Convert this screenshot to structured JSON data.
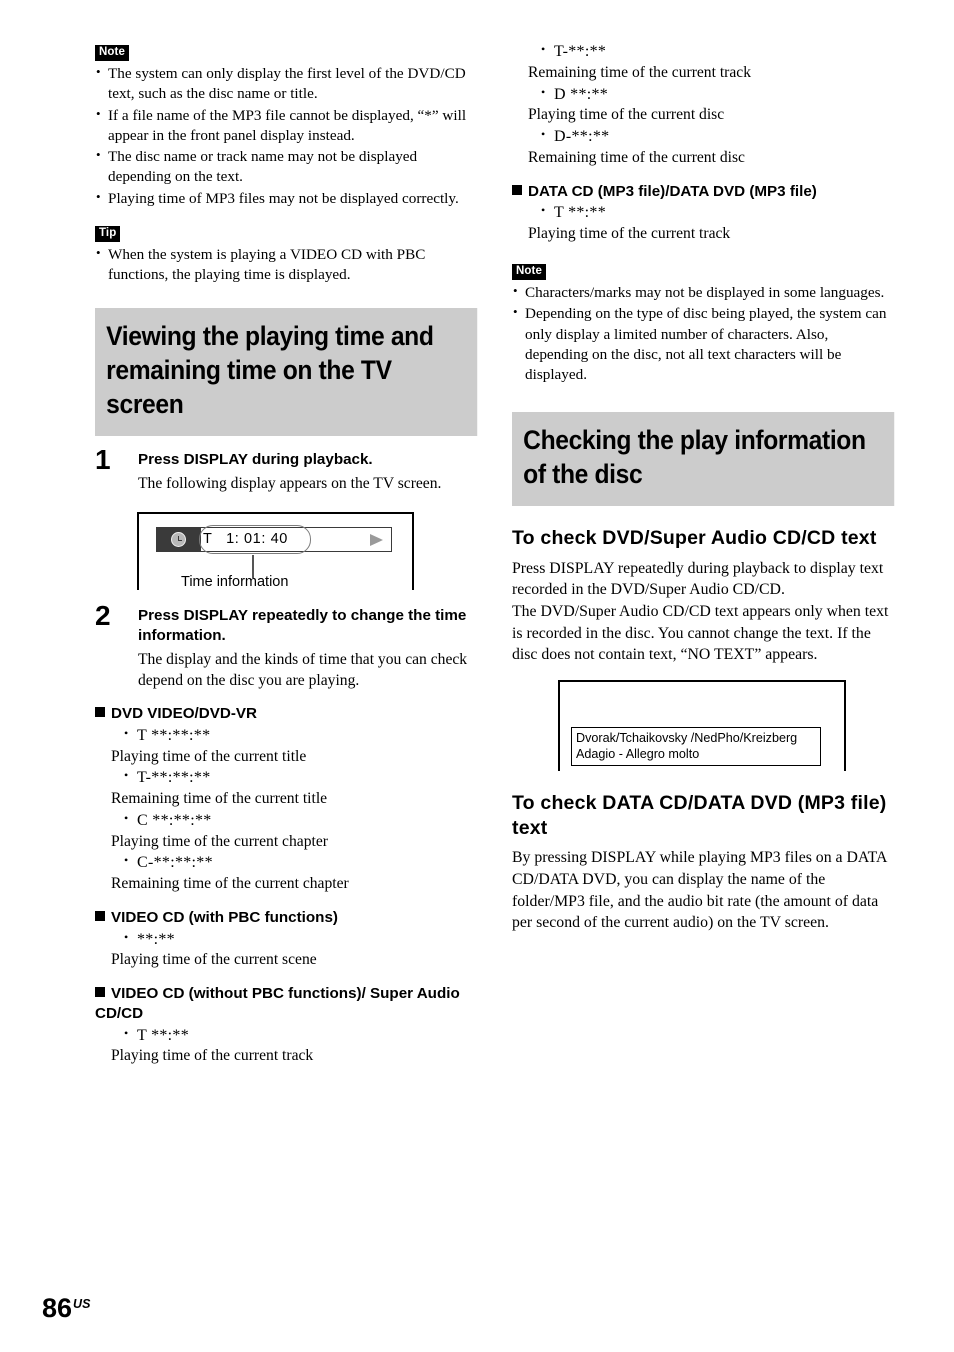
{
  "page": {
    "number": "86",
    "region_suffix": "US"
  },
  "labels": {
    "note": "Note",
    "tip": "Tip"
  },
  "left_column": {
    "note_items": [
      "The system can only display the first level of the DVD/CD text, such as the disc name or title.",
      "If a file name of the MP3 file cannot be displayed, “*” will appear in the front panel display instead.",
      "The disc name or track name may not be displayed depending on the text.",
      "Playing time of MP3 files may not be displayed correctly."
    ],
    "tip_items": [
      "When the system is playing a VIDEO CD with PBC functions, the playing time is displayed."
    ],
    "section_heading": "Viewing the playing time and remaining time on the TV screen",
    "step1": {
      "number": "1",
      "title": "Press DISPLAY during playback.",
      "body": "The following display appears on the TV screen."
    },
    "figure_tv": {
      "time_text": "T   1: 01: 40",
      "caption": "Time information",
      "clock_icon": "clock-icon",
      "play_icon": "play-triangle-icon"
    },
    "step2": {
      "number": "2",
      "title": "Press DISPLAY repeatedly to change the time information.",
      "body": "The display and the kinds of time that you can check depend on the disc you are playing."
    },
    "groups": [
      {
        "heading": "DVD VIDEO/DVD-VR",
        "entries": [
          {
            "code": "T **:**:**",
            "desc": "Playing time of the current title"
          },
          {
            "code": "T-**:**:**",
            "desc": "Remaining time of the current title"
          },
          {
            "code": "C **:**:**",
            "desc": "Playing time of the current chapter"
          },
          {
            "code": "C-**:**:**",
            "desc": "Remaining time of the current chapter"
          }
        ]
      },
      {
        "heading": "VIDEO CD (with PBC functions)",
        "entries": [
          {
            "code": "**:**",
            "desc": "Playing time of the current scene"
          }
        ]
      },
      {
        "heading": "VIDEO CD (without PBC functions)/ Super Audio CD/CD",
        "entries": [
          {
            "code": "T **:**",
            "desc": "Playing time of the current track"
          }
        ]
      }
    ]
  },
  "right_column": {
    "continued_entries": [
      {
        "code": "T-**:**",
        "desc": "Remaining time of the current track"
      },
      {
        "code": "D **:**",
        "desc": "Playing time of the current disc"
      },
      {
        "code": "D-**:**",
        "desc": "Remaining time of the current disc"
      }
    ],
    "data_group": {
      "heading": "DATA CD (MP3 file)/DATA DVD (MP3 file)",
      "entries": [
        {
          "code": "T **:**",
          "desc": "Playing time of the current track"
        }
      ]
    },
    "note_items": [
      "Characters/marks may not be displayed in some languages.",
      "Depending on the type of disc being played, the system can only display a limited number of characters. Also, depending on the disc, not all text characters will be displayed."
    ],
    "section_heading": "Checking the play information of the disc",
    "sub1": {
      "title": "To check DVD/Super Audio CD/CD text",
      "para1": "Press DISPLAY repeatedly during playback to display text recorded in the DVD/Super Audio CD/CD.",
      "para2": "The DVD/Super Audio CD/CD text appears only when text is recorded in the disc. You cannot change the text. If the disc does not contain text, “NO TEXT” appears."
    },
    "figure_text": {
      "line1": "Dvorak/Tchaikovsky /NedPho/Kreizberg",
      "line2": "Adagio - Allegro molto"
    },
    "sub2": {
      "title": "To check DATA CD/DATA DVD (MP3 file) text",
      "para1": "By pressing DISPLAY while playing MP3 files on a DATA CD/DATA DVD, you can display the name of the folder/MP3 file, and the audio bit rate (the amount of data per second of the current audio) on the TV screen."
    }
  },
  "colors": {
    "heading_background": "#cccccc",
    "badge_background": "#000000",
    "osd_dark": "#3a3a3a",
    "osd_play_gray": "#9a9a9a"
  }
}
